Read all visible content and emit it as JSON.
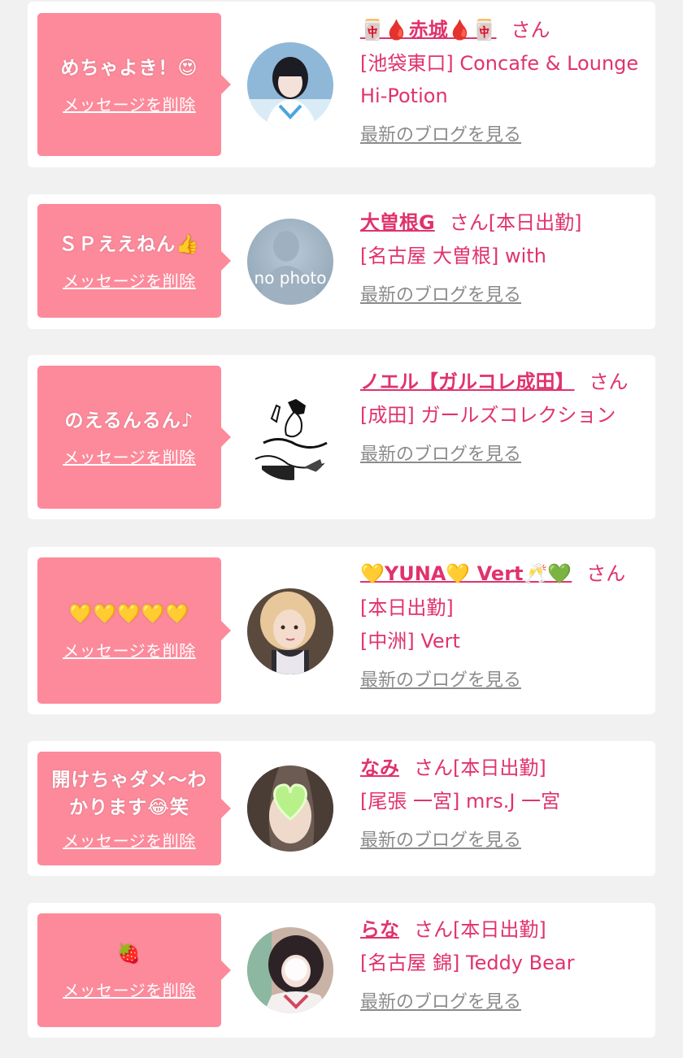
{
  "common": {
    "delete_label": "メッセージを削除",
    "blog_label": "最新のブログを見る",
    "san": "さん",
    "working": "[本日出勤]"
  },
  "messages": [
    {
      "message": "めちゃよき！😍",
      "name": "🀄🩸赤城🩸🀄",
      "shop": "[池袋東口] Concafe & Lounge Hi-Potion",
      "working": false,
      "avatar": "photo-girl-blue-dress"
    },
    {
      "message": "ＳＰええねん👍",
      "name": "大曽根G",
      "shop": "[名古屋 大曽根] with",
      "working": true,
      "avatar": "no-photo",
      "avatar_text": "no photo"
    },
    {
      "message": "のえるんるん♪",
      "name": "ノエル【ガルコレ成田】",
      "shop": "[成田] ガールズコレクション",
      "working": false,
      "avatar": "manga-drawing"
    },
    {
      "message": "💛💛💛💛💛",
      "name": "💛YUNA💛 Vert🥂💚",
      "shop": "[中洲] Vert",
      "working": true,
      "avatar": "photo-girl-blonde"
    },
    {
      "message": "開けちゃダメ〜わかります😂笑",
      "name": "なみ",
      "shop": "[尾張 一宮] mrs.J 一宮",
      "working": true,
      "avatar": "photo-heart-sticker"
    },
    {
      "message": "🍓",
      "name": "らな",
      "shop": "[名古屋 錦] Teddy Bear",
      "working": true,
      "avatar": "photo-girl-blurred"
    }
  ]
}
